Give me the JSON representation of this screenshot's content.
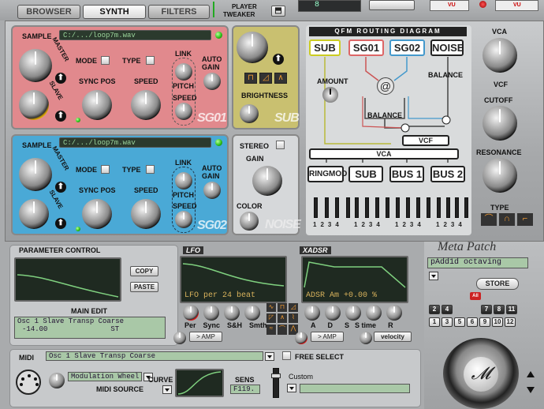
{
  "top": {
    "tabs": [
      "BROWSER",
      "SYNTH",
      "FILTERS"
    ],
    "active_tab": "SYNTH",
    "player_label": "PLAYER",
    "tweaker_label": "TWEAKER",
    "display_value": "8",
    "vu_label": "VU"
  },
  "sg01": {
    "sample_label": "SAMPLE",
    "path": "C:/.../loop7m.wav",
    "master": "MASTER",
    "slave": "SLAVE",
    "mode": "MODE",
    "type": "TYPE",
    "link": "LINK",
    "auto_gain_1": "AUTO",
    "auto_gain_2": "GAIN",
    "sync_pos": "SYNC POS",
    "speed": "SPEED",
    "pitch": "PITCH",
    "speed2": "SPEED",
    "name": "SG01"
  },
  "sg02": {
    "sample_label": "SAMPLE",
    "path": "C:/.../loop7m.wav",
    "master": "MASTER",
    "slave": "SLAVE",
    "mode": "MODE",
    "type": "TYPE",
    "link": "LINK",
    "auto_gain_1": "AUTO",
    "auto_gain_2": "GAIN",
    "sync_pos": "SYNC POS",
    "speed": "SPEED",
    "pitch": "PITCH",
    "speed2": "SPEED",
    "name": "SG02"
  },
  "sub": {
    "brightness": "BRIGHTNESS",
    "name": "SUB"
  },
  "noise": {
    "stereo": "STEREO",
    "gain": "GAIN",
    "color": "COLOR",
    "name": "NOISE"
  },
  "routing": {
    "title": "QFM ROUTING DIAGRAM",
    "sources": [
      "SUB",
      "SG01",
      "SG02",
      "NOISE"
    ],
    "amount": "AMOUNT",
    "balance_1": "BALANCE",
    "balance_2": "BALANCE",
    "vcf": "VCF",
    "vca": "VCA",
    "buses": [
      "RINGMOD",
      "SUB",
      "BUS 1",
      "BUS 2"
    ],
    "slider_nums": [
      "1",
      "2",
      "3",
      "4"
    ]
  },
  "right": {
    "vca": "VCA",
    "vcf": "VCF",
    "cutoff": "CUTOFF",
    "resonance": "RESONANCE",
    "type": "TYPE"
  },
  "param": {
    "title": "PARAMETER CONTROL",
    "copy": "COPY",
    "paste": "PASTE",
    "main_edit": "MAIN EDIT",
    "line1": "Osc 1 Slave Transp Coarse",
    "line2_val": "-14.00",
    "line2_unit": "ST"
  },
  "lfo": {
    "title": "LFO",
    "readout": "LFO per   24   beat",
    "knobs": [
      "Per",
      "Sync",
      "S&H",
      "Smth"
    ],
    "target": "> AMP"
  },
  "adsr": {
    "title": "XADSR",
    "readout": "ADSR Am +0.00    %",
    "knobs": [
      "A",
      "D",
      "S",
      "time",
      "R"
    ],
    "s_prefix": "S",
    "target": "> AMP",
    "velocity": "velocity"
  },
  "meta": {
    "title": "Meta Patch",
    "patch": "pAdd1d octaving",
    "store": "STORE",
    "all": "All",
    "row1": [
      "2",
      "4",
      "7",
      "8",
      "11"
    ],
    "row2": [
      "1",
      "3",
      "5",
      "6",
      "9",
      "10",
      "12"
    ]
  },
  "midi": {
    "title": "MIDI",
    "source_value": "Modulation Wheel",
    "source_label": "MIDI SOURCE",
    "target_value": "Osc 1 Slave Transp Coarse",
    "free_select": "FREE SELECT",
    "curve": "CURVE",
    "sens": "SENS",
    "sens_value": "F119.",
    "custom": "Custom"
  }
}
